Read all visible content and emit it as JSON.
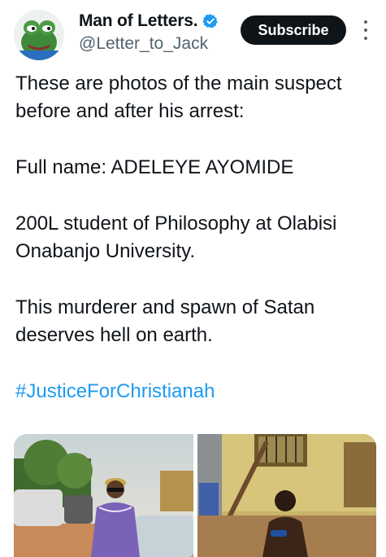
{
  "author": {
    "name": "Man of Letters.",
    "handle": "@Letter_to_Jack",
    "verified": true,
    "avatar_icon": "frog-avatar"
  },
  "actions": {
    "subscribe_label": "Subscribe",
    "more_icon": "more-vertical-icon"
  },
  "tweet": {
    "line1": "These are photos of the main suspect before and after his arrest:",
    "line2": "Full name: ADELEYE AYOMIDE",
    "line3": "200L student of Philosophy at Olabisi Onabanjo University.",
    "line4": "This murderer and spawn of Satan deserves hell on earth.",
    "hashtag": "#JusticeForChristianah"
  },
  "colors": {
    "accent": "#1d9bf0",
    "text": "#0f1419",
    "muted": "#536471"
  },
  "media": {
    "count": 2
  }
}
